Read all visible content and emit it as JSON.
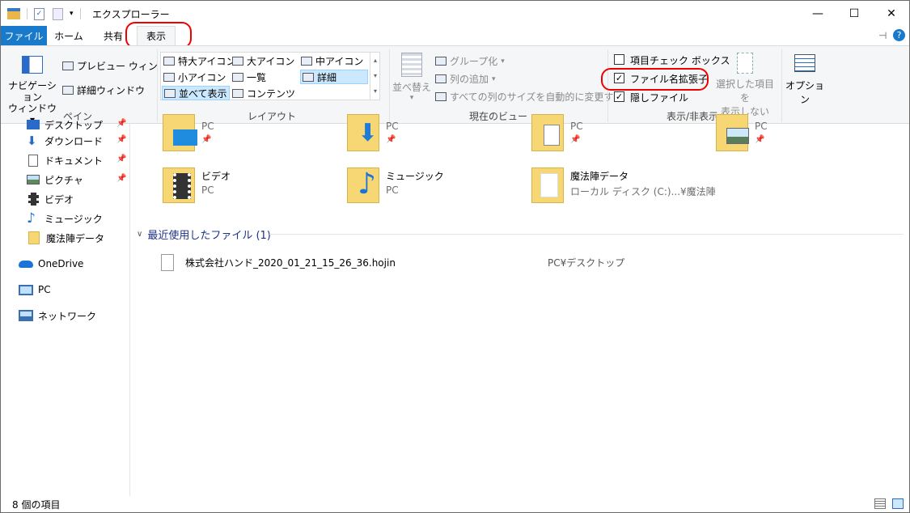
{
  "window": {
    "title": "エクスプローラー",
    "minimize": "—",
    "maximize": "☐",
    "close": "✕"
  },
  "tabs": [
    {
      "label": "ファイル"
    },
    {
      "label": "ホーム"
    },
    {
      "label": "共有"
    },
    {
      "label": "表示"
    }
  ],
  "ribbon": {
    "pane": {
      "nav_pane_line1": "ナビゲーション",
      "nav_pane_line2": "ウィンドウ ▾",
      "preview": "プレビュー ウィンドウ",
      "details": "詳細ウィンドウ",
      "group": "ペイン"
    },
    "layout": {
      "items": [
        "特大アイコン",
        "大アイコン",
        "中アイコン",
        "小アイコン",
        "一覧",
        "詳細",
        "並べて表示",
        "コンテンツ"
      ],
      "selected": "並べて表示",
      "group": "レイアウト"
    },
    "current_view": {
      "sort": "並べ替え",
      "group_by": "グループ化",
      "add_columns": "列の追加",
      "fit_columns": "すべての列のサイズを自動的に変更する",
      "group": "現在のビュー"
    },
    "show_hide": {
      "item_checkboxes": "項目チェック ボックス",
      "file_extensions": "ファイル名拡張子",
      "hidden_items": "隠しファイル",
      "hide_selected_line1": "選択した項目を",
      "hide_selected_line2": "表示しない",
      "group": "表示/非表示"
    },
    "options": {
      "label": "オプション"
    }
  },
  "nav": {
    "items": [
      {
        "label": "デスクトップ",
        "pinned": true
      },
      {
        "label": "ダウンロード",
        "pinned": true
      },
      {
        "label": "ドキュメント",
        "pinned": true
      },
      {
        "label": "ピクチャ",
        "pinned": true
      },
      {
        "label": "ビデオ",
        "pinned": false
      },
      {
        "label": "ミュージック",
        "pinned": false
      },
      {
        "label": "魔法陣データ",
        "pinned": false
      },
      {
        "label": "OneDrive",
        "pinned": false
      },
      {
        "label": "PC",
        "pinned": false
      },
      {
        "label": "ネットワーク",
        "pinned": false
      }
    ],
    "pin_glyph": "📌"
  },
  "folders": [
    {
      "name": "",
      "sub": "PC"
    },
    {
      "name": "",
      "sub": "PC"
    },
    {
      "name": "",
      "sub": "PC"
    },
    {
      "name": "",
      "sub": "PC"
    },
    {
      "name": "ビデオ",
      "sub": "PC"
    },
    {
      "name": "ミュージック",
      "sub": "PC"
    },
    {
      "name": "魔法陣データ",
      "sub": "ローカル ディスク (C:)...¥魔法陣"
    }
  ],
  "recent": {
    "header": "最近使用したファイル (1)",
    "files": [
      {
        "name": "株式会社ハンド_2020_01_21_15_26_36.hojin",
        "location": "PC¥デスクトップ"
      }
    ]
  },
  "status": {
    "count": "8 個の項目"
  },
  "colors": {
    "accent": "#1979ca",
    "highlight_ring": "#e00000",
    "folder": "#f2c94c"
  }
}
